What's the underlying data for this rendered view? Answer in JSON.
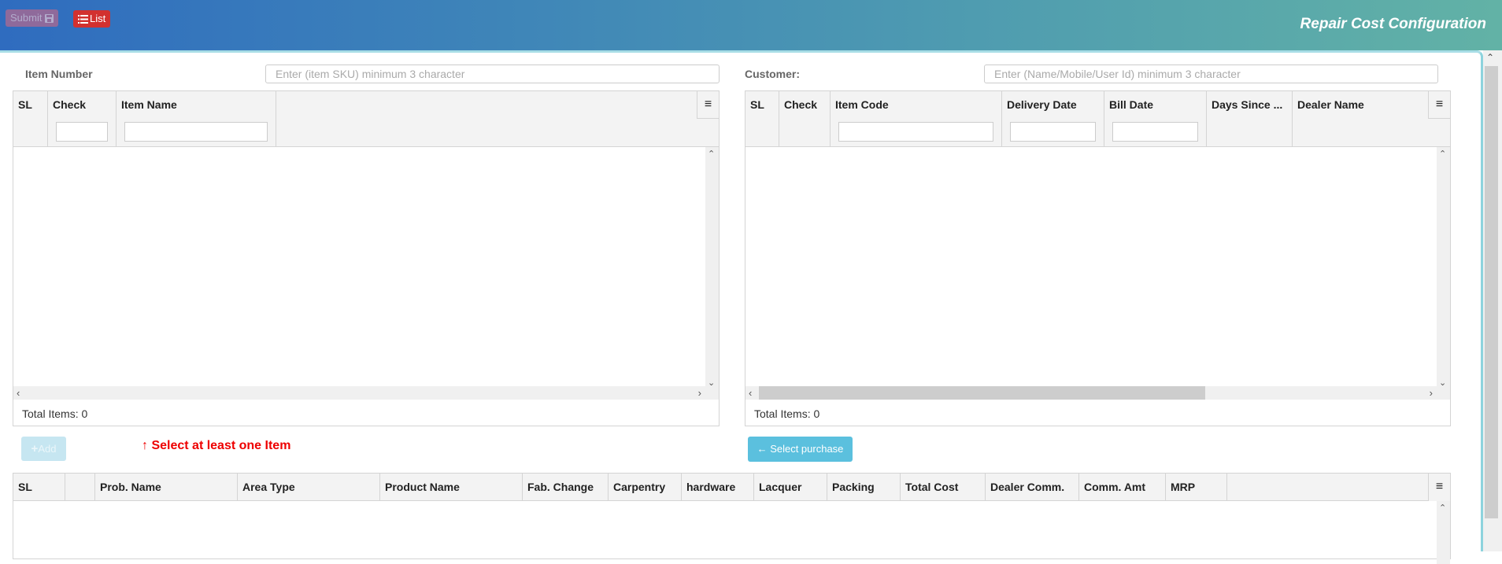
{
  "header": {
    "submit_label": "Submit",
    "list_label": "List",
    "title": "Repair Cost Configuration",
    "colors": {
      "list_button": "#d2312f",
      "submit_button": "#a06a95"
    }
  },
  "item_panel": {
    "label": "Item Number",
    "search_placeholder": "Enter (item SKU) minimum 3 character",
    "columns": [
      "SL",
      "Check",
      "Item Name"
    ],
    "total_items": "Total Items: 0"
  },
  "customer_panel": {
    "label": "Customer:",
    "search_placeholder": "Enter (Name/Mobile/User Id) minimum 3 character",
    "columns": [
      "SL",
      "Check",
      "Item Code",
      "Delivery Date",
      "Bill Date",
      "Days Since ...",
      "Dealer Name"
    ],
    "total_items": "Total Items: 0"
  },
  "actions": {
    "add_label": "Add",
    "warning": "Select at least one Item",
    "select_purchase_label": "Select purchase",
    "colors": {
      "warning": "#ee0000",
      "select_purchase": "#5bc0de"
    }
  },
  "cost_grid": {
    "columns": [
      "SL",
      "",
      "Prob. Name",
      "Area Type",
      "Product Name",
      "Fab. Change",
      "Carpentry",
      "hardware",
      "Lacquer",
      "Packing",
      "Total Cost",
      "Dealer Comm.",
      "Comm. Amt",
      "MRP"
    ]
  },
  "icons": {
    "save": "💾",
    "list": "☰",
    "plus": "+",
    "arrow_up": "↑",
    "arrow_left": "←",
    "menu": "≡"
  }
}
